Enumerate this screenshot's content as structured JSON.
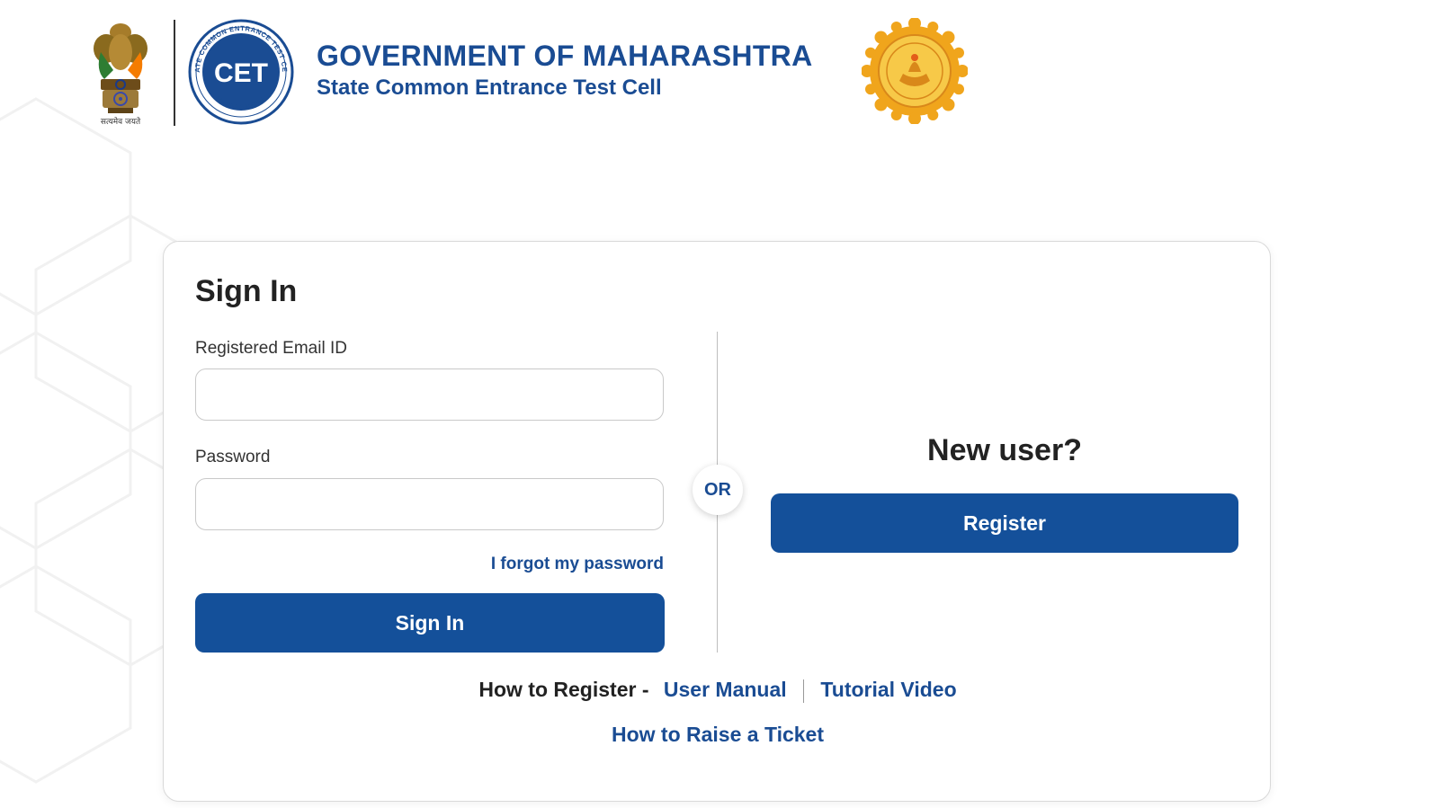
{
  "header": {
    "emblem_caption": "सत्यमेव जयते",
    "cet_logo_text": "CET",
    "cet_ring_top": "STATE COMMON ENTRANCE TEST CELL",
    "cet_ring_bottom": "MAHARASHTRA",
    "title": "GOVERNMENT OF MAHARASHTRA",
    "subtitle": "State Common Entrance Test Cell"
  },
  "signin": {
    "heading": "Sign In",
    "email_label": "Registered Email ID",
    "email_value": "",
    "password_label": "Password",
    "password_value": "",
    "forgot_link": "I forgot my password",
    "submit_label": "Sign In"
  },
  "divider": {
    "or_label": "OR"
  },
  "register": {
    "heading": "New user?",
    "button_label": "Register"
  },
  "help": {
    "how_to_register": "How to Register -",
    "user_manual": "User Manual",
    "tutorial_video": "Tutorial Video",
    "raise_ticket": "How to Raise a Ticket"
  },
  "colors": {
    "brand_blue": "#14509a",
    "link_blue": "#1a4c93",
    "seal_gold": "#f0a51c"
  },
  "icons": {
    "emblem": "national-emblem-icon",
    "cet": "cet-logo-icon",
    "seal": "maharashtra-seal-icon"
  }
}
